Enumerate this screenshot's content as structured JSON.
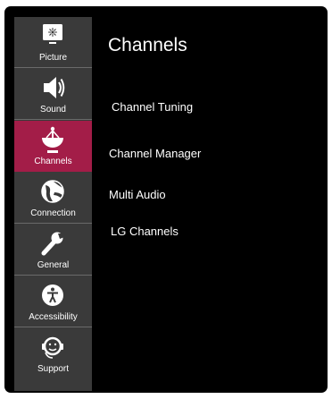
{
  "sidebar": {
    "items": [
      {
        "label": "Picture",
        "icon": "picture-icon"
      },
      {
        "label": "Sound",
        "icon": "speaker-icon"
      },
      {
        "label": "Channels",
        "icon": "satellite-dish-icon",
        "active": true
      },
      {
        "label": "Connection",
        "icon": "globe-icon"
      },
      {
        "label": "General",
        "icon": "wrench-icon"
      },
      {
        "label": "Accessibility",
        "icon": "accessibility-icon"
      },
      {
        "label": "Support",
        "icon": "headset-icon"
      }
    ]
  },
  "main": {
    "title": "Channels",
    "options": [
      {
        "label": "Channel Tuning"
      },
      {
        "label": "Channel Manager"
      },
      {
        "label": "Multi Audio"
      },
      {
        "label": "LG Channels"
      }
    ]
  },
  "colors": {
    "active": "#a31d48",
    "sidebar": "#3a3a3a",
    "background": "#000000"
  }
}
